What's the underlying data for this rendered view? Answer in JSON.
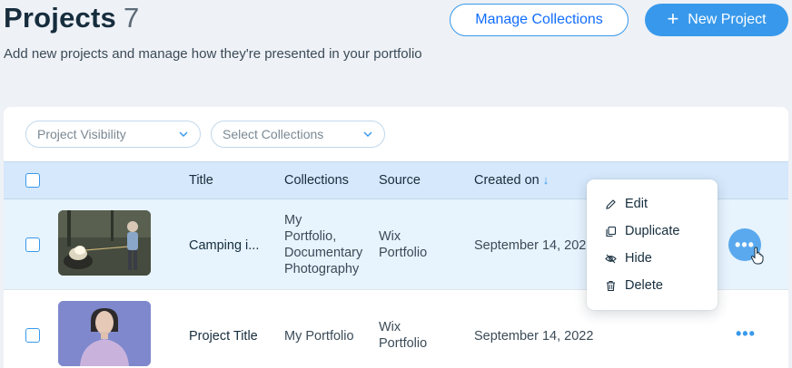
{
  "header": {
    "title": "Projects",
    "count": "7",
    "subtitle": "Add new projects and manage how they're presented in your portfolio",
    "manage_collections_label": "Manage Collections",
    "new_project_label": "New Project",
    "plus_glyph": "+"
  },
  "filters": {
    "visibility_placeholder": "Project Visibility",
    "collections_placeholder": "Select Collections"
  },
  "table": {
    "columns": {
      "title": "Title",
      "collections": "Collections",
      "source": "Source",
      "created_on": "Created on",
      "sort_icon": "arrow-down-icon"
    },
    "rows": [
      {
        "title": "Camping i...",
        "collections_lines": [
          "My",
          "Portfolio,",
          "Documentary",
          "Photography"
        ],
        "source_lines": [
          "Wix",
          "Portfolio"
        ],
        "created_on": "September 14, 2022"
      },
      {
        "title": "Project Title",
        "collections": "My Portfolio",
        "source_lines": [
          "Wix",
          "Portfolio"
        ],
        "created_on": "September 14, 2022"
      }
    ]
  },
  "more_glyph": "•••",
  "context_menu": {
    "items": [
      {
        "label": "Edit",
        "icon": "pencil-icon"
      },
      {
        "label": "Duplicate",
        "icon": "duplicate-icon"
      },
      {
        "label": "Hide",
        "icon": "eye-slash-icon"
      },
      {
        "label": "Delete",
        "icon": "trash-icon"
      }
    ]
  },
  "colors": {
    "accent": "#3899ec",
    "header_row_bg": "#d6e8fb",
    "selected_row_bg": "#e7f3fd",
    "page_bg": "#eef1f6"
  }
}
